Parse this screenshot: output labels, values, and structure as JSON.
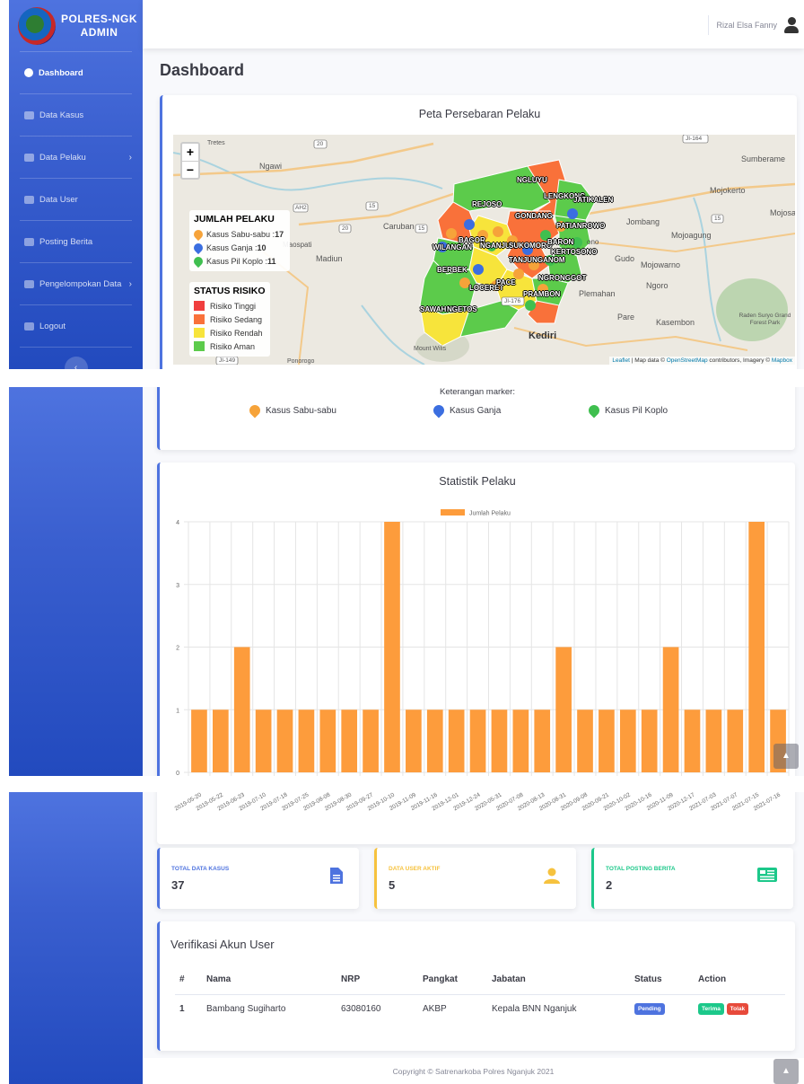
{
  "brand": {
    "line1": "POLRES-NGK",
    "line2": "ADMIN"
  },
  "sidebar": {
    "items": [
      {
        "label": "Dashboard",
        "icon": "tachometer-icon"
      },
      {
        "label": "Data Kasus",
        "icon": "file-icon"
      },
      {
        "label": "Data Pelaku",
        "icon": "users-icon",
        "chevron": "›"
      },
      {
        "label": "Data User",
        "icon": "user-icon"
      },
      {
        "label": "Posting Berita",
        "icon": "newspaper-icon"
      },
      {
        "label": "Pengelompokan Data",
        "icon": "users-cog-icon",
        "chevron": "›"
      },
      {
        "label": "Logout",
        "icon": "sign-out-icon"
      }
    ],
    "toggle": "‹"
  },
  "topbar": {
    "user_name": "Rizal Elsa Fanny"
  },
  "page": {
    "title": "Dashboard"
  },
  "map_card": {
    "title": "Peta Persebaran Pelaku",
    "zoom_in": "+",
    "zoom_out": "−",
    "legend_pelaku": {
      "title": "JUMLAH PELAKU",
      "rows": [
        {
          "label": "Kasus Sabu-sabu :",
          "count": "17",
          "color": "#f6a33a"
        },
        {
          "label": "Kasus Ganja :",
          "count": "10",
          "color": "#3b6ee0"
        },
        {
          "label": "Kasus Pil Koplo :",
          "count": "11",
          "color": "#3fbf4f"
        }
      ]
    },
    "legend_risiko": {
      "title": "STATUS RISIKO",
      "rows": [
        {
          "label": "Risiko Tinggi",
          "color": "#f03e3e"
        },
        {
          "label": "Risiko Sedang",
          "color": "#f9713a"
        },
        {
          "label": "Risiko Rendah",
          "color": "#f7e43b"
        },
        {
          "label": "Risiko Aman",
          "color": "#5ccb4b"
        }
      ]
    },
    "places": [
      "Tretes",
      "Ngawi",
      "Caruban",
      "Maospati",
      "Madiun",
      "Ponorogo",
      "Mount Wilis",
      "Kediri",
      "Pare",
      "Kasembon",
      "Plemahan",
      "Ngoro",
      "Gudo",
      "Mojowarno",
      "Jombang",
      "Mojoagung",
      "Mojokerto",
      "Sumberame",
      "Mojosari",
      "Raden Suryo Grand Forest Park",
      "ono"
    ],
    "road_labels": [
      "20",
      "AH2",
      "15",
      "20",
      "15",
      "15",
      "JI-164",
      "JI-176",
      "JI-149"
    ],
    "districts": [
      "NGLUYU",
      "LENGKONG",
      "JATIKALEN",
      "REJOSO",
      "GONDANG",
      "PATIANROWO",
      "BAGOR",
      "WILANGAN",
      "NGANJUK",
      "SUKOMORO",
      "BARON",
      "KERTOSONO",
      "BERBEK",
      "TANJUNGANOM",
      "LOCERET",
      "PACE",
      "NGRONGGOT",
      "PRAMBON",
      "SAWAHAN",
      "NGETOS"
    ],
    "attribution": {
      "leaflet": "Leaflet",
      "text1": " | Map data © ",
      "osm": "OpenStreetMap",
      "text2": " contributors, Imagery © ",
      "mapbox": "Mapbox"
    },
    "marker_caption": "Keterangan marker:",
    "marker_legend": [
      {
        "label": "Kasus Sabu-sabu",
        "color": "#f6a33a"
      },
      {
        "label": "Kasus Ganja",
        "color": "#3b6ee0"
      },
      {
        "label": "Kasus Pil Koplo",
        "color": "#3fbf4f"
      }
    ]
  },
  "chart_card": {
    "title": "Statistik Pelaku"
  },
  "chart_data": {
    "type": "bar",
    "title": "Statistik Pelaku",
    "series": [
      {
        "name": "Jumlah Pelaku",
        "color": "#fd9c3c",
        "values": [
          1,
          1,
          2,
          1,
          1,
          1,
          1,
          1,
          1,
          4,
          1,
          1,
          1,
          1,
          1,
          1,
          1,
          2,
          1,
          1,
          1,
          1,
          2,
          1,
          1,
          1,
          4,
          1
        ]
      }
    ],
    "categories": [
      "2019-05-20",
      "2019-05-22",
      "2019-06-23",
      "2019-07-10",
      "2019-07-18",
      "2019-07-25",
      "2019-08-08",
      "2019-08-30",
      "2019-09-27",
      "2019-10-10",
      "2019-11-09",
      "2019-11-16",
      "2019-12-01",
      "2019-12-24",
      "2020-05-31",
      "2020-07-08",
      "2020-08-13",
      "2020-08-31",
      "2020-09-08",
      "2020-09-21",
      "2020-10-02",
      "2020-10-16",
      "2020-11-09",
      "2020-12-17",
      "2021-07-03",
      "2021-07-07",
      "2021-07-15",
      "2021-07-16"
    ],
    "ylim": [
      0,
      4
    ],
    "yticks": [
      "0",
      "1",
      "2",
      "3",
      "4"
    ],
    "grid": true,
    "legend": "top"
  },
  "stats": [
    {
      "label": "TOTAL DATA KASUS",
      "value": "37",
      "color": "#4e73df",
      "icon": "file-alt-icon"
    },
    {
      "label": "DATA USER AKTIF",
      "value": "5",
      "color": "#f6c23e",
      "icon": "user-icon"
    },
    {
      "label": "TOTAL POSTING BERITA",
      "value": "2",
      "color": "#1cc88a",
      "icon": "newspaper-icon"
    }
  ],
  "verify": {
    "title": "Verifikasi Akun User",
    "headers": [
      "#",
      "Nama",
      "NRP",
      "Pangkat",
      "Jabatan",
      "Status",
      "Action"
    ],
    "rows": [
      {
        "no": "1",
        "nama": "Bambang Sugiharto",
        "nrp": "63080160",
        "pangkat": "AKBP",
        "jabatan": "Kepala BNN Nganjuk",
        "status": "Pending",
        "accept": "Terima",
        "reject": "Tolak"
      }
    ]
  },
  "footer": {
    "copyright": "Copyright © Satrenarkoba Polres Nganjuk 2021"
  },
  "scroll_top": "▲"
}
